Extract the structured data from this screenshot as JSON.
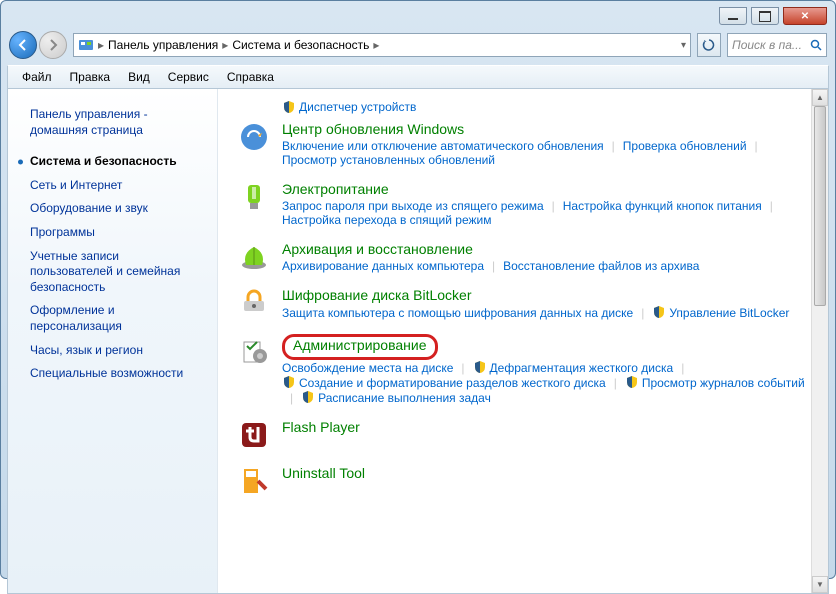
{
  "titlebar": {
    "min": "",
    "max": "",
    "close": ""
  },
  "breadcrumb": {
    "root": "Панель управления",
    "current": "Система и безопасность"
  },
  "search": {
    "placeholder": "Поиск в па..."
  },
  "menu": {
    "file": "Файл",
    "edit": "Правка",
    "view": "Вид",
    "tools": "Сервис",
    "help": "Справка"
  },
  "sidebar": {
    "home": "Панель управления - домашняя страница",
    "items": [
      "Система и безопасность",
      "Сеть и Интернет",
      "Оборудование и звук",
      "Программы",
      "Учетные записи пользователей и семейная безопасность",
      "Оформление и персонализация",
      "Часы, язык и регион",
      "Специальные возможности"
    ]
  },
  "top_task": "Диспетчер устройств",
  "categories": [
    {
      "title": "Центр обновления Windows",
      "tasks": [
        "Включение или отключение автоматического обновления",
        "Проверка обновлений",
        "Просмотр установленных обновлений"
      ],
      "shields": [
        false,
        false,
        false
      ]
    },
    {
      "title": "Электропитание",
      "tasks": [
        "Запрос пароля при выходе из спящего режима",
        "Настройка функций кнопок питания",
        "Настройка перехода в спящий режим"
      ],
      "shields": [
        false,
        false,
        false
      ]
    },
    {
      "title": "Архивация и восстановление",
      "tasks": [
        "Архивирование данных компьютера",
        "Восстановление файлов из архива"
      ],
      "shields": [
        false,
        false
      ]
    },
    {
      "title": "Шифрование диска BitLocker",
      "tasks": [
        "Защита компьютера с помощью шифрования данных на диске",
        "Управление BitLocker"
      ],
      "shields": [
        false,
        true
      ]
    },
    {
      "title": "Администрирование",
      "highlight": true,
      "tasks": [
        "Освобождение места на диске",
        "Дефрагментация жесткого диска",
        "Создание и форматирование разделов жесткого диска",
        "Просмотр журналов событий",
        "Расписание выполнения задач"
      ],
      "shields": [
        false,
        true,
        true,
        true,
        true
      ]
    },
    {
      "title": "Flash Player",
      "tasks": [],
      "shields": []
    },
    {
      "title": "Uninstall Tool",
      "tasks": [],
      "shields": []
    }
  ]
}
